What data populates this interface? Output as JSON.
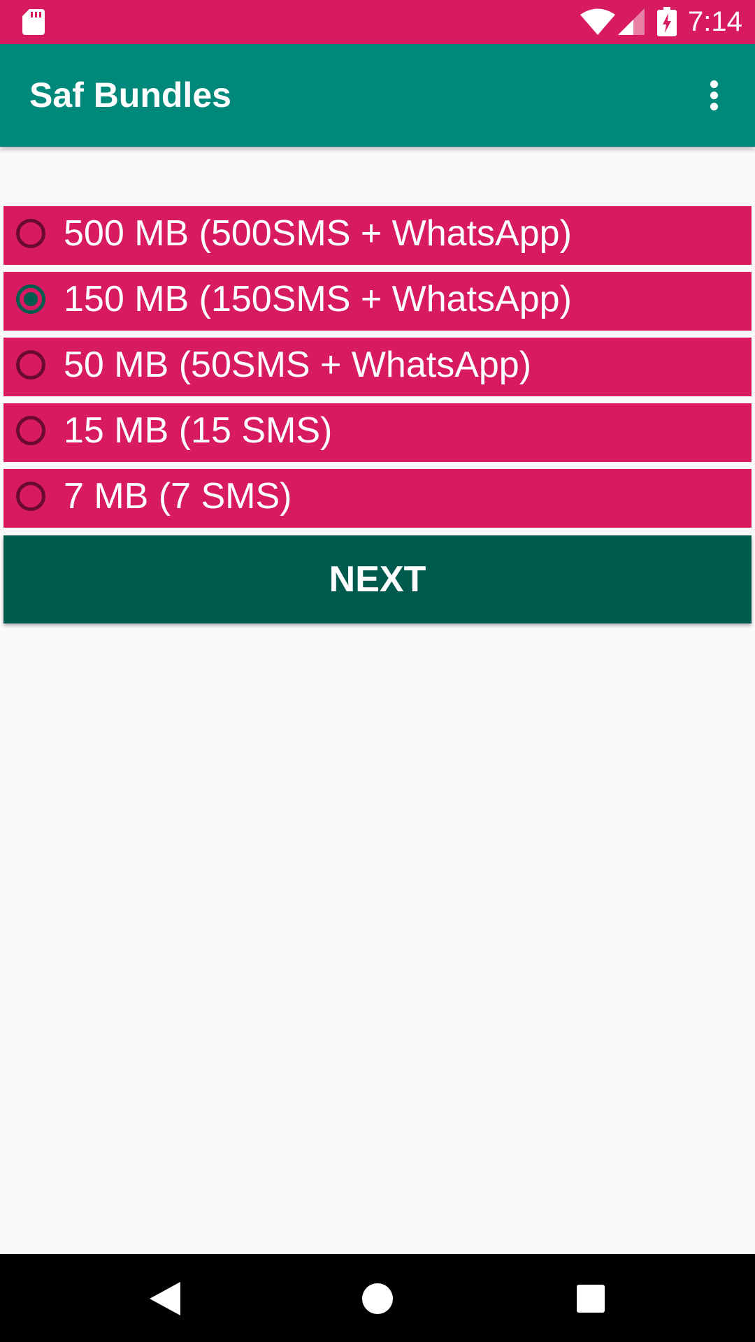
{
  "status_bar": {
    "time": "7:14",
    "icons": [
      "sd-card-icon",
      "wifi-icon",
      "cell-signal-icon",
      "battery-charging-icon"
    ],
    "background": "#d81b60"
  },
  "app_bar": {
    "title": "Saf Bundles",
    "overflow_icon": "more-vert-icon",
    "background": "#00897b"
  },
  "options": [
    {
      "label": "500 MB (500SMS + WhatsApp)",
      "checked": false
    },
    {
      "label": "150 MB (150SMS + WhatsApp)",
      "checked": true
    },
    {
      "label": "50 MB (50SMS + WhatsApp)",
      "checked": false
    },
    {
      "label": "15 MB (15 SMS)",
      "checked": false
    },
    {
      "label": "7 MB (7 SMS)",
      "checked": false
    }
  ],
  "next_button": {
    "label": "NEXT",
    "background": "#005a4d"
  },
  "colors": {
    "option_background": "#d81b60",
    "page_background": "#fafafa"
  },
  "nav_bar": {
    "icons": [
      "back-icon",
      "home-icon",
      "recents-icon"
    ]
  }
}
